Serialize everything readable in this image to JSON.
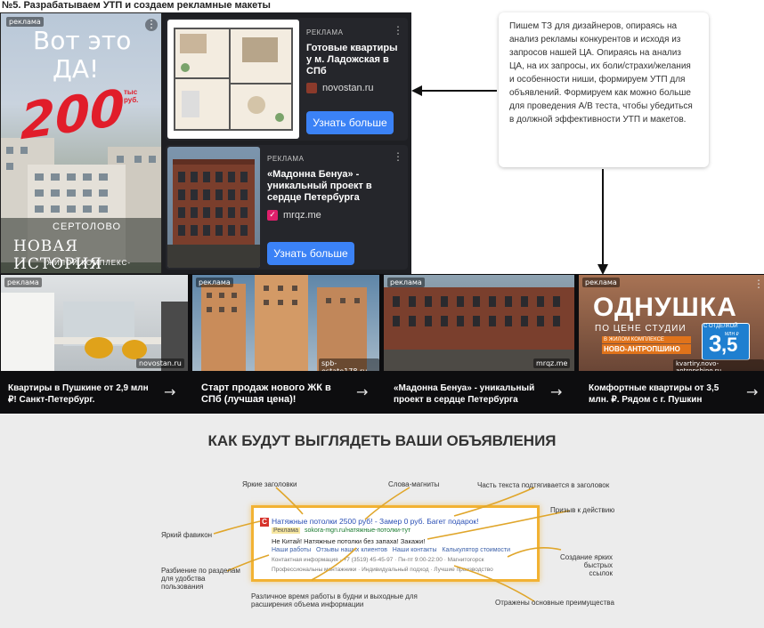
{
  "header": {
    "title": "№5.  Разрабатываем УТП и создаем рекламные макеты"
  },
  "left_ad": {
    "badge": "реклама",
    "headline_line1": "Вот это",
    "headline_line2": "ДА!",
    "price": "200",
    "price_unit": "тыс руб.",
    "location": "СЕРТОЛОВО",
    "project": "НОВАЯ ИСТОРИЯ",
    "subtitle": "-ЖИЛОЙ КОМПЛЕКС-"
  },
  "ad1": {
    "label": "РЕКЛАМА",
    "title": "Готовые квартиры у м. Ладожская в СПб",
    "domain": "novostan.ru",
    "button": "Узнать больше"
  },
  "ad2": {
    "label": "РЕКЛАМА",
    "title": "«Мадонна Бенуа» - уникальный проект в сердце Петербурга",
    "domain": "mrqz.me",
    "button": "Узнать больше"
  },
  "note": {
    "text": "Пишем ТЗ для дизайнеров, опираясь на анализ рекламы конкурентов и исходя из запросов нашей ЦА. Опираясь на анализ ЦА, на их запросы, их боли/страхи/желания и особенности ниши, формируем УТП для объявлений. Формируем как можно больше для проведения A/B теста, чтобы убедиться в должной эффективности УТП и макетов."
  },
  "bottom_ads": [
    {
      "badge": "реклама",
      "domain": "novostan.ru",
      "caption": "Квартиры в Пушкине от 2,9 млн ₽! Санкт-Петербург."
    },
    {
      "badge": "реклама",
      "domain": "spb-estate178.ru",
      "caption": "Старт продаж нового ЖК в СПб (лучшая цена)!"
    },
    {
      "badge": "реклама",
      "domain": "mrqz.me",
      "caption": "«Мадонна Бенуа» - уникальный проект в сердце Петербурга"
    },
    {
      "badge": "реклама",
      "domain": "kvartiry.novo-antropshino.ru",
      "caption": "Комфортные квартиры от 3,5 млн. ₽. Рядом с г. Пушкин"
    }
  ],
  "odnushka": {
    "title": "ОДНУШКА",
    "line2": "ПО ЦЕНЕ СТУДИИ",
    "line3": "В ЖИЛОМ КОМПЛЕКСЕ",
    "line4": "НОВО-АНТРОПШИНО",
    "finish": "С ОТДЕЛКОЙ",
    "price": "3",
    "price_dec": ",5",
    "price_unit": "МЛН ₽"
  },
  "diagram": {
    "title": "КАК БУДУТ ВЫГЛЯДЕТЬ ВАШИ ОБЪЯВЛЕНИЯ",
    "ad_headline": "Натяжные потолки 2500 руб! - Замер 0 руб. Багет подарок!",
    "ad_label": "Реклама",
    "ad_url": "sokora-mgn.ru/натяжные-потолки-тут",
    "ad_text": "Не Китай! Натяжные потолки без запаха! Закажи!",
    "ad_links": "Наши работы   Отзывы наших клиентов   Наши контакты   Калькулятор стоимости",
    "ad_contact": "Контактная информация · +7 (3519) 45-45-97 · Пн-пт 9:00-22:00 · Магнитогорск",
    "ad_extra": "Профессиональны монтажники · Индивидуальный подход · Лучшие производство",
    "callouts": {
      "headlines": "Яркие заголовки",
      "magnets": "Слова-магниты",
      "part_text": "Часть текста подтягивается в заголовок",
      "cta": "Призыв к действию",
      "favicon": "Яркий фавикон",
      "sections": "Разбиение по разделам для удобства пользования",
      "fast_links": "Создание ярких быстрых ссылок",
      "hours": "Различное время работы в будни и выходные для расширения объема информации",
      "advantages": "Отражены основные преимущества"
    }
  },
  "colors": {
    "accent_blue": "#3b82f6",
    "dark_card": "#1e1f23",
    "orange_frame": "#f2b233",
    "diagram_bg": "#ececec"
  }
}
